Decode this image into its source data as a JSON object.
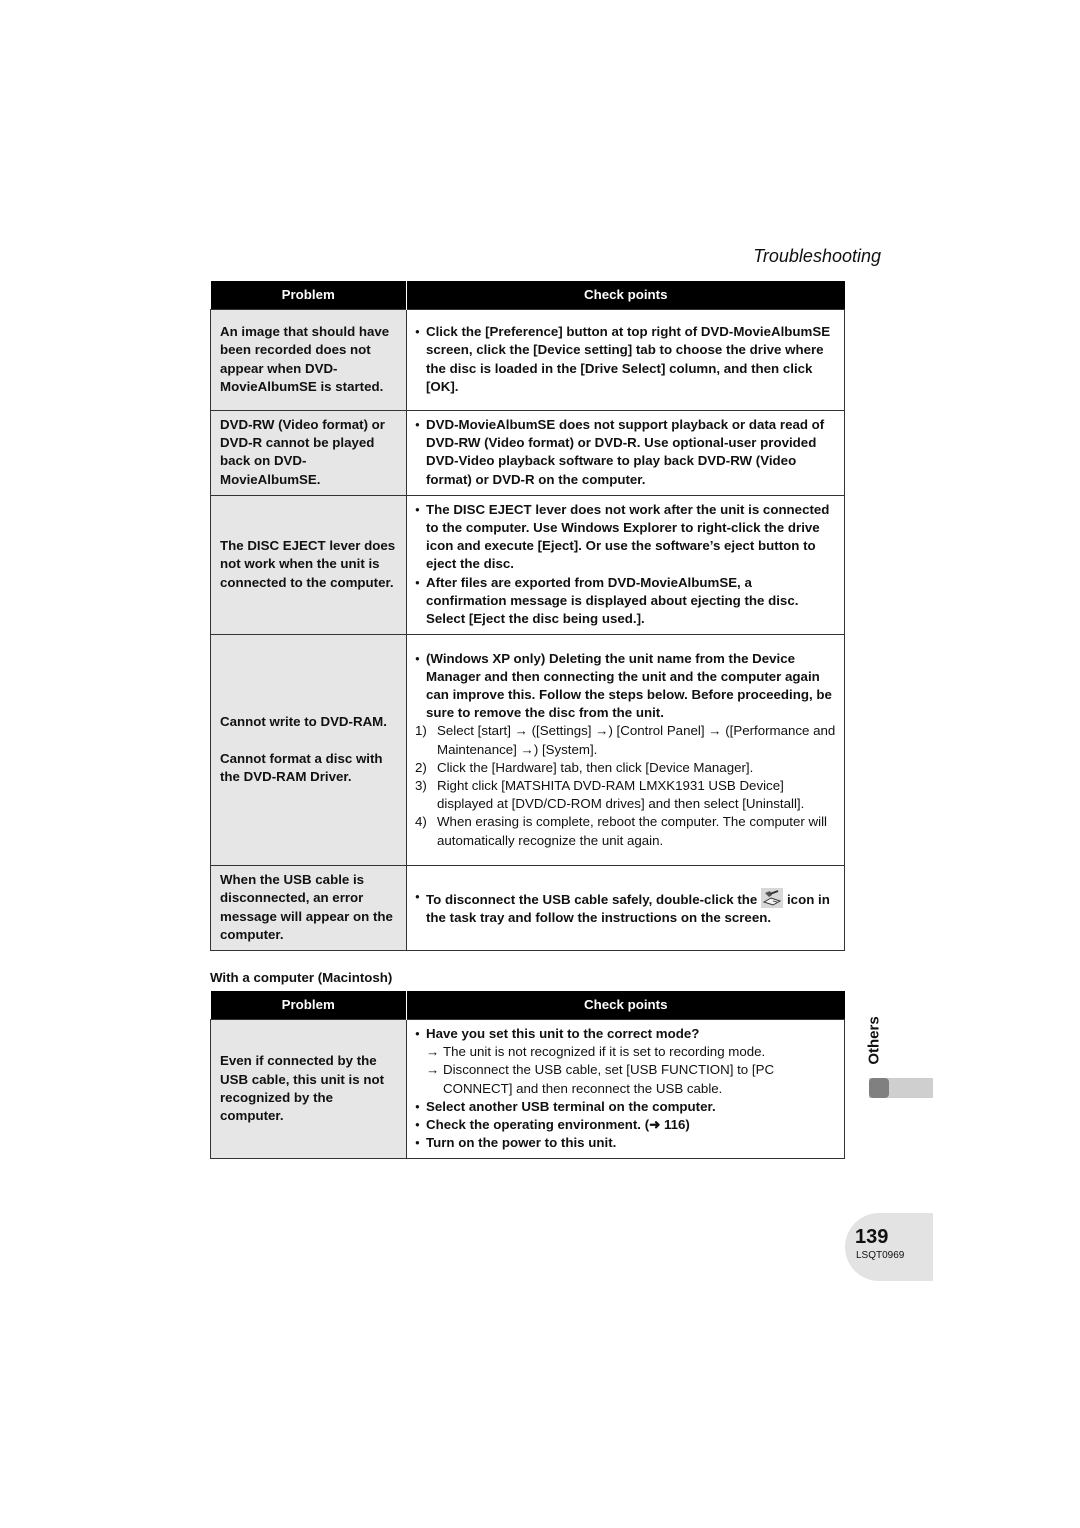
{
  "header": {
    "section_title": "Troubleshooting"
  },
  "table1": {
    "headers": {
      "problem": "Problem",
      "check": "Check points"
    },
    "rows": [
      {
        "problem": "An image that should have been recorded does not appear when DVD-MovieAlbumSE is started.",
        "bullets": [
          "Click the [Preference] button at top right of DVD-MovieAlbumSE screen, click the [Device setting] tab to choose the drive where the disc is loaded in the [Drive Select] column, and then click [OK]."
        ]
      },
      {
        "problem": "DVD-RW (Video format) or DVD-R cannot be played back on DVD-MovieAlbumSE.",
        "bullets": [
          "DVD-MovieAlbumSE does not support playback or data read of DVD-RW (Video format) or DVD-R. Use optional-user provided DVD-Video playback software to play back DVD-RW (Video format) or DVD-R on the computer."
        ]
      },
      {
        "problem": "The DISC EJECT lever does not work when the unit is connected to the computer.",
        "bullets": [
          "The DISC EJECT lever does not work after the unit is connected to the computer. Use Windows Explorer to right-click the drive icon and execute [Eject]. Or use the software’s eject button to eject the disc.",
          "After files are exported from DVD-MovieAlbumSE, a confirmation message is displayed about ejecting the disc. Select [Eject the disc being used.]."
        ]
      },
      {
        "problem_a": "Cannot write to DVD-RAM.",
        "problem_b": "Cannot format a disc with the DVD-RAM Driver.",
        "bullets": [
          "(Windows XP only) Deleting the unit name from the Device Manager and then connecting the unit and the computer again can improve this. Follow the steps below. Before proceeding, be sure to remove the disc from the unit."
        ],
        "steps": [
          {
            "num": "1)",
            "text": "Select [start] → ([Settings] →) [Control Panel] → ([Performance and Maintenance] →) [System]."
          },
          {
            "num": "2)",
            "text": "Click the [Hardware] tab, then click [Device Manager]."
          },
          {
            "num": "3)",
            "text": "Right click [MATSHITA DVD-RAM LMXK1931 USB Device] displayed at [DVD/CD-ROM drives] and then select [Uninstall]."
          },
          {
            "num": "4)",
            "text": "When erasing is complete, reboot the computer. The computer will automatically recognize the unit again."
          }
        ]
      },
      {
        "problem": "When the USB cable is disconnected, an error message will appear on the computer.",
        "bullet_before_icon": "To disconnect the USB cable safely, double-click the",
        "icon": "safely-remove-hardware-icon",
        "bullet_after_icon": "icon in the task tray and follow the instructions on the screen."
      }
    ]
  },
  "mac_caption": "With a computer (Macintosh)",
  "table2": {
    "headers": {
      "problem": "Problem",
      "check": "Check points"
    },
    "rows": [
      {
        "problem": "Even if connected by the USB cable, this unit is not recognized by the computer.",
        "bullet1": "Have you set this unit to the correct mode?",
        "subs": [
          {
            "arrow": "→",
            "text": "The unit is not recognized if it is set to recording mode."
          },
          {
            "arrow": "→",
            "text": "Disconnect the USB cable, set [USB FUNCTION] to [PC CONNECT] and then reconnect the USB cable."
          }
        ],
        "bullet2": "Select another USB terminal on the computer.",
        "bullet3": "Check the operating environment. (➜ 116)",
        "bullet4": "Turn on the power to this unit."
      }
    ]
  },
  "side": {
    "label": "Others"
  },
  "footer": {
    "page_number": "139",
    "doc_code": "LSQT0969"
  }
}
